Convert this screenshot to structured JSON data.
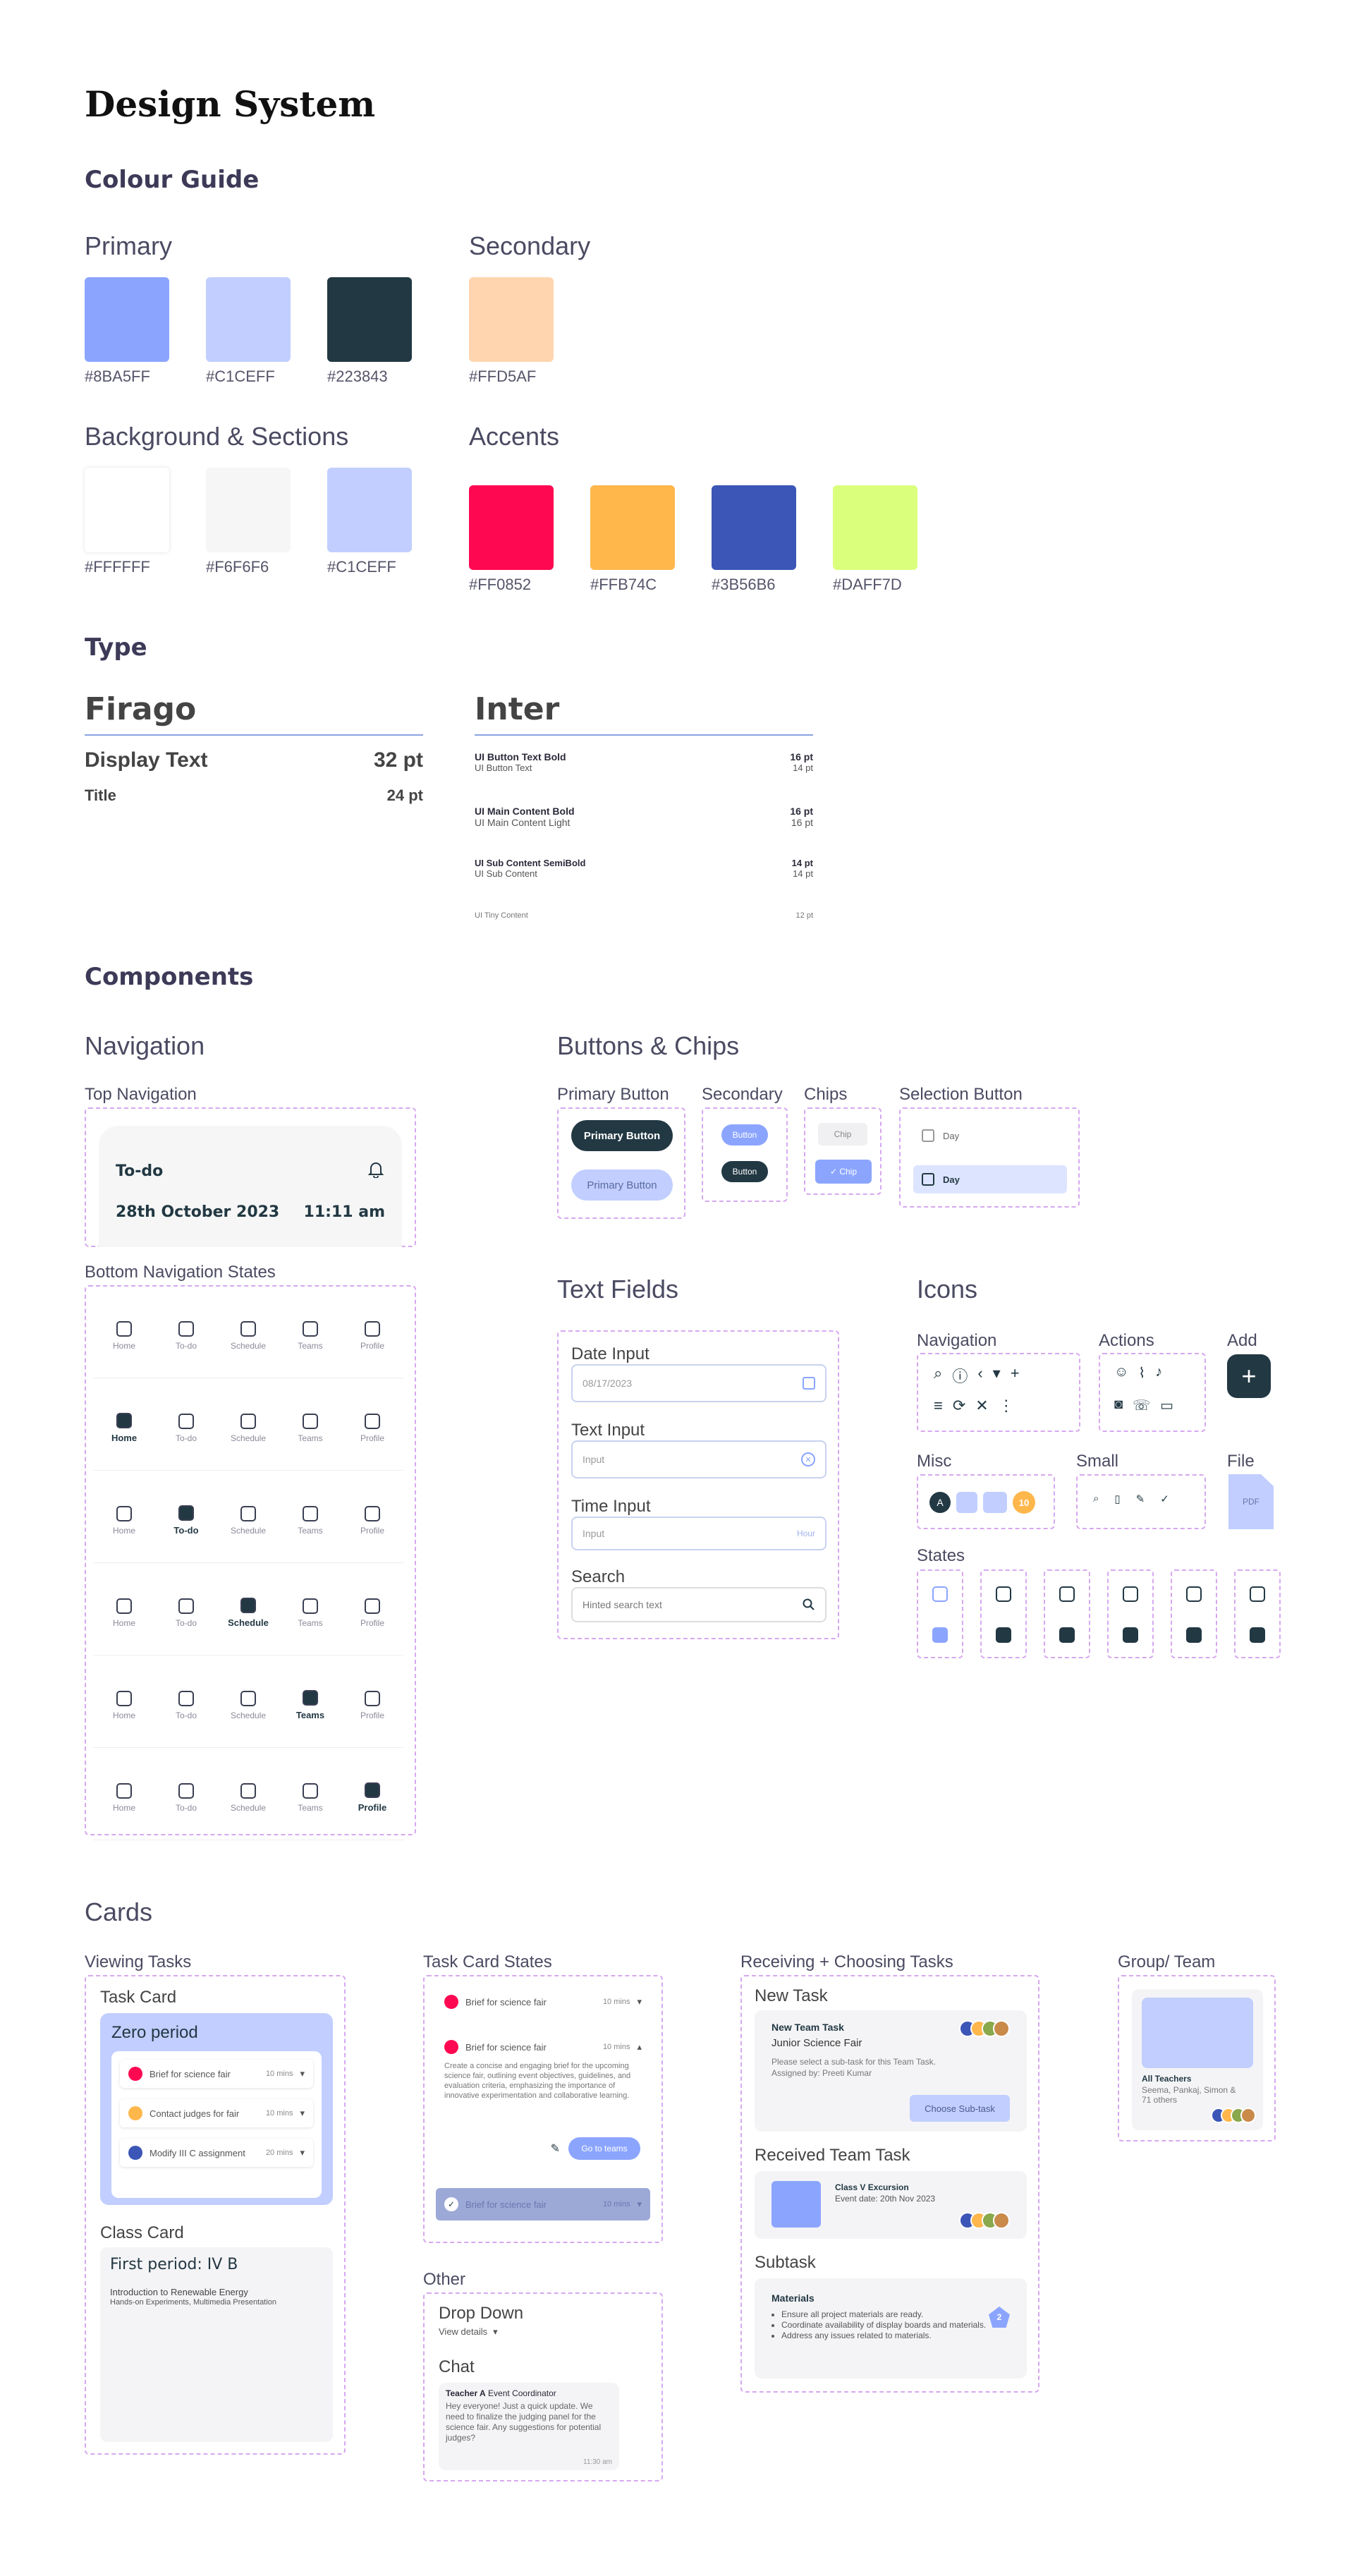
{
  "title": "Design System",
  "colour_guide": {
    "heading": "Colour Guide",
    "primary": {
      "label": "Primary",
      "swatches": [
        {
          "hex": "#8BA5FF"
        },
        {
          "hex": "#C1CEFF"
        },
        {
          "hex": "#223843"
        }
      ]
    },
    "secondary": {
      "label": "Secondary",
      "swatches": [
        {
          "hex": "#FFD5AF"
        }
      ]
    },
    "background": {
      "label": "Background & Sections",
      "swatches": [
        {
          "hex": "#FFFFFF"
        },
        {
          "hex": "#F6F6F6"
        },
        {
          "hex": "#C1CEFF"
        }
      ]
    },
    "accents": {
      "label": "Accents",
      "swatches": [
        {
          "hex": "#FF0852"
        },
        {
          "hex": "#FFB74C"
        },
        {
          "hex": "#3B56B6"
        },
        {
          "hex": "#DAFF7D"
        }
      ]
    }
  },
  "type": {
    "heading": "Type",
    "firago": {
      "name": "Firago",
      "rows": [
        {
          "label": "Display Text",
          "size": "32 pt"
        },
        {
          "label": "Title",
          "size": "24 pt"
        }
      ]
    },
    "inter": {
      "name": "Inter",
      "rows": [
        {
          "bold": "UI Button Text Bold",
          "bold_size": "16 pt",
          "light": "UI Button Text",
          "light_size": "14 pt"
        },
        {
          "bold": "UI Main Content Bold",
          "bold_size": "16 pt",
          "light": "UI Main Content Light",
          "light_size": "16 pt"
        },
        {
          "bold": "UI Sub Content SemiBold",
          "bold_size": "14 pt",
          "light": "UI Sub Content",
          "light_size": "14 pt"
        },
        {
          "bold": "",
          "bold_size": "",
          "light": "UI Tiny Content",
          "light_size": "12 pt"
        }
      ]
    }
  },
  "components": {
    "heading": "Components",
    "navigation": {
      "heading": "Navigation",
      "top_label": "Top Navigation",
      "top": {
        "title": "To-do",
        "date": "28th October 2023",
        "time": "11:11 am"
      },
      "bottom_label": "Bottom Navigation States",
      "items": [
        "Home",
        "To-do",
        "Schedule",
        "Teams",
        "Profile"
      ]
    },
    "buttons": {
      "heading": "Buttons & Chips",
      "primary_label": "Primary Button",
      "primary_text": "Primary Button",
      "secondary_label": "Secondary",
      "secondary_text": "Button",
      "chips_label": "Chips",
      "chip_text": "Chip",
      "chip_selected_text": "✓ Chip",
      "selection_label": "Selection Button",
      "selection_text": "Day"
    },
    "text_fields": {
      "heading": "Text Fields",
      "date": {
        "label": "Date Input",
        "value": "08/17/2023"
      },
      "text": {
        "label": "Text Input",
        "placeholder": "Input"
      },
      "time": {
        "label": "Time Input",
        "placeholder": "Input",
        "suffix": "Hour"
      },
      "search": {
        "label": "Search",
        "placeholder": "Hinted search text"
      }
    },
    "icons": {
      "heading": "Icons",
      "navigation_label": "Navigation",
      "actions_label": "Actions",
      "add_label": "Add",
      "misc_label": "Misc",
      "small_label": "Small",
      "file_label": "File",
      "file_text": "PDF",
      "states_label": "States",
      "misc_avatar": "A",
      "misc_badge": "10"
    }
  },
  "cards": {
    "heading": "Cards",
    "viewing_label": "Viewing Tasks",
    "task_card_label": "Task Card",
    "task_card": {
      "title": "Zero period",
      "tasks": [
        {
          "text": "Brief for science fair",
          "time": "10 mins",
          "color": "#FF0852"
        },
        {
          "text": "Contact judges for fair",
          "time": "10 mins",
          "color": "#FFB74C"
        },
        {
          "text": "Modify III C assignment",
          "time": "20 mins",
          "color": "#3B56B6"
        }
      ]
    },
    "class_card_label": "Class Card",
    "class_card": {
      "title": "First period: IV B",
      "line1": "Introduction to Renewable Energy",
      "line2": "Hands-on Experiments, Multimedia Presentation"
    },
    "states_label": "Task Card States",
    "states": {
      "task": "Brief for science fair",
      "time": "10 mins",
      "desc": "Create a concise and engaging brief for the upcoming science fair, outlining event objectives, guidelines, and evaluation criteria, emphasizing the importance of innovative experimentation and collaborative learning.",
      "button": "Go to teams"
    },
    "other_label": "Other",
    "dropdown_label": "Drop Down",
    "dropdown_text": "View details",
    "chat_label": "Chat",
    "chat": {
      "sender": "Teacher A",
      "role": "Event Coordinator",
      "message": "Hey everyone! Just a quick update. We need to finalize the judging panel for the science fair. Any suggestions for potential judges?",
      "time": "11:30 am"
    },
    "receiving_label": "Receiving + Choosing Tasks",
    "new_task_label": "New Task",
    "new_task": {
      "title": "New Team Task",
      "sub": "Junior Science Fair",
      "desc": "Please select a sub-task for this Team Task.",
      "assigned": "Assigned by: Preeti Kumar",
      "button": "Choose Sub-task"
    },
    "received_label": "Received Team Task",
    "received": {
      "title": "Class V Excursion",
      "date": "Event date: 20th Nov 2023"
    },
    "subtask_label": "Subtask",
    "subtask": {
      "title": "Materials",
      "items": [
        "Ensure all project materials are ready.",
        "Coordinate availability of display boards and materials.",
        "Address any issues related to materials."
      ],
      "badge": "2"
    },
    "group_label": "Group/ Team",
    "group": {
      "title": "All Teachers",
      "members": "Seema, Pankaj, Simon & 71 others"
    }
  }
}
